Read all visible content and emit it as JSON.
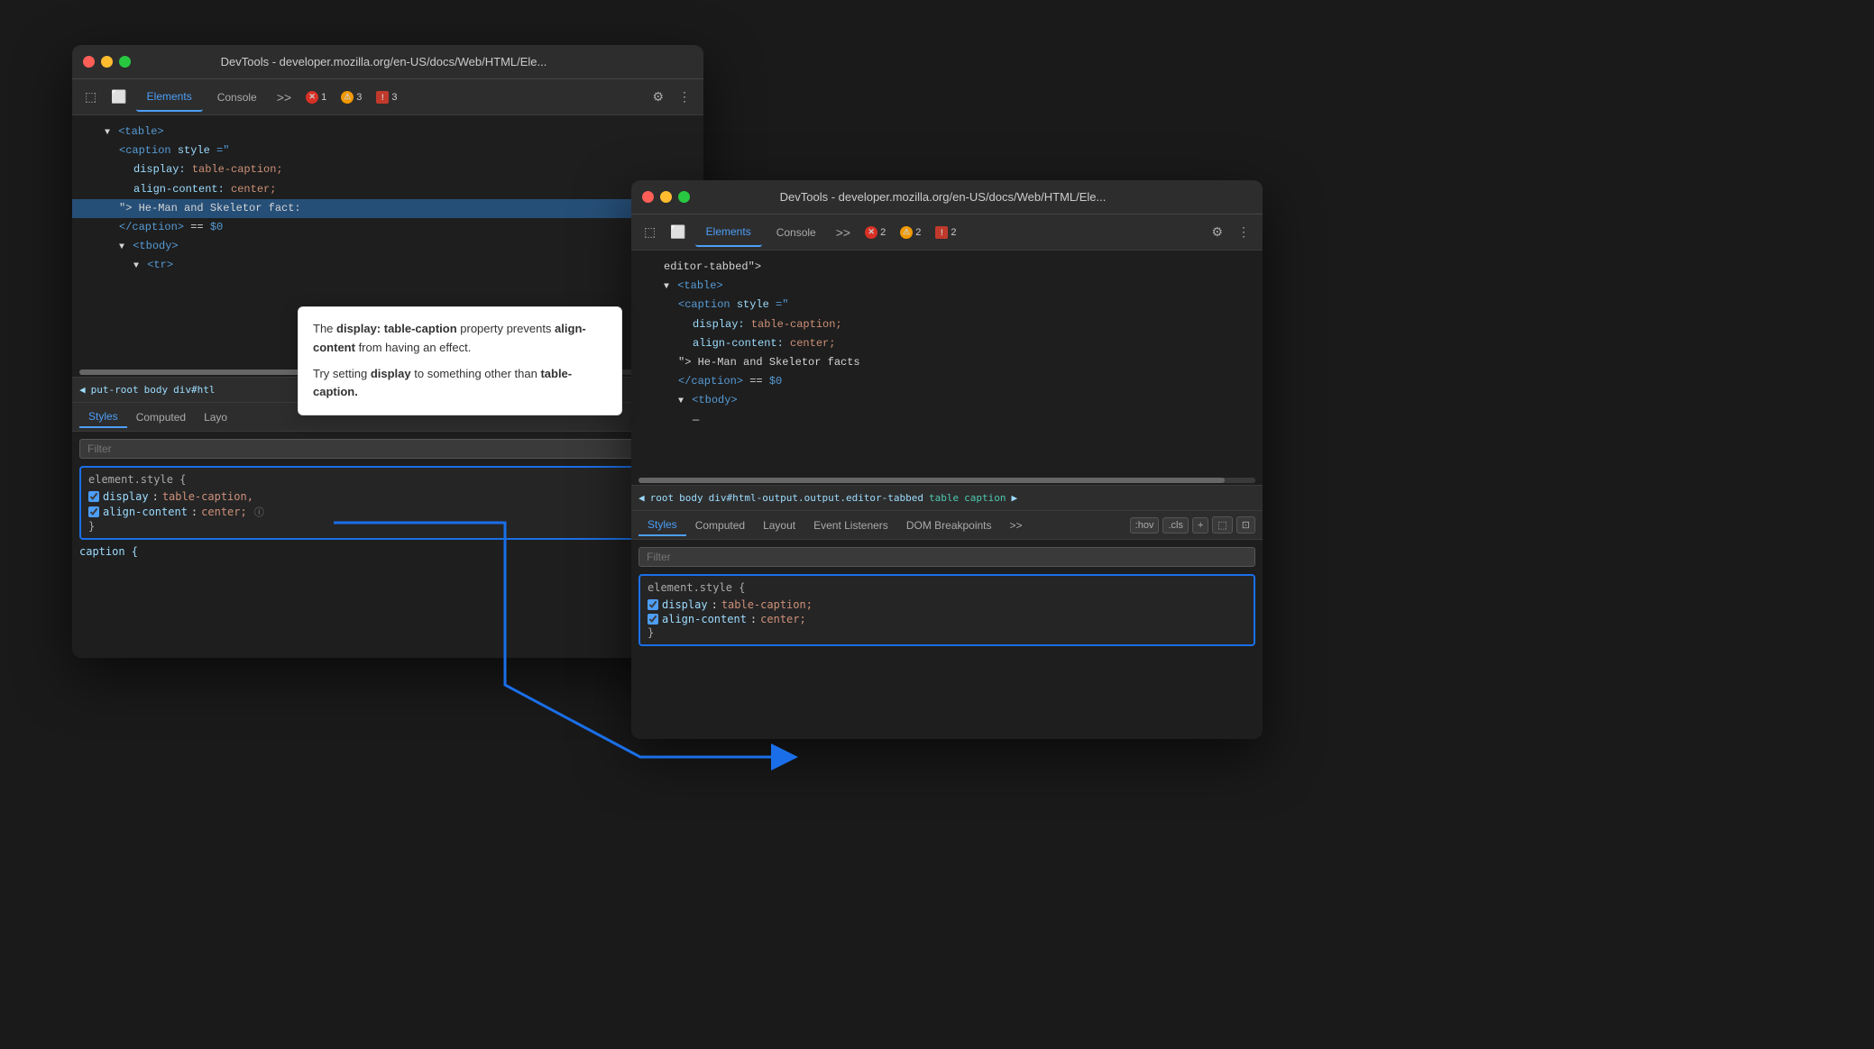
{
  "window1": {
    "title": "DevTools - developer.mozilla.org/en-US/docs/Web/HTML/Ele...",
    "tabs": [
      "Elements",
      "Console"
    ],
    "activeTab": "Elements",
    "badgeError": "1",
    "badgeWarn": "3",
    "badgeInfo": "3",
    "htmlTree": [
      {
        "indent": 0,
        "content": "▼ <table>",
        "type": "tag"
      },
      {
        "indent": 1,
        "content": "<caption style=\"",
        "type": "tag"
      },
      {
        "indent": 2,
        "content": "display: table-caption;",
        "type": "css"
      },
      {
        "indent": 2,
        "content": "align-content: center;",
        "type": "css"
      },
      {
        "indent": 1,
        "content": "\"> He-Man and Skeletor fact:",
        "type": "text",
        "selected": true
      },
      {
        "indent": 1,
        "content": "</caption> == $0",
        "type": "tag"
      },
      {
        "indent": 1,
        "content": "▼ <tbody>",
        "type": "tag"
      },
      {
        "indent": 2,
        "content": "▼ <tr>",
        "type": "tag"
      }
    ],
    "breadcrumb": [
      "◀",
      "put-root",
      "body",
      "div#htl"
    ],
    "panelTabs": [
      "Styles",
      "Computed",
      "Layo"
    ],
    "filterPlaceholder": "Filter",
    "styleRule": {
      "header": "element.style {",
      "props": [
        {
          "name": "display",
          "value": "table-caption,",
          "checked": true
        },
        {
          "name": "align-content",
          "value": "center;",
          "checked": true
        }
      ],
      "footer": "}"
    }
  },
  "window2": {
    "title": "DevTools - developer.mozilla.org/en-US/docs/Web/HTML/Ele...",
    "tabs": [
      "Elements",
      "Console"
    ],
    "activeTab": "Elements",
    "badgeError": "2",
    "badgeWarn": "2",
    "badgeInfo": "2",
    "htmlTree": [
      {
        "indent": 0,
        "content": "editor-tabbed\">",
        "type": "text"
      },
      {
        "indent": 0,
        "content": "▼ <table>",
        "type": "tag"
      },
      {
        "indent": 1,
        "content": "<caption style=\"",
        "type": "tag"
      },
      {
        "indent": 2,
        "content": "display: table-caption;",
        "type": "css"
      },
      {
        "indent": 2,
        "content": "align-content: center;",
        "type": "css"
      },
      {
        "indent": 1,
        "content": "\"> He-Man and Skeletor facts",
        "type": "text"
      },
      {
        "indent": 1,
        "content": "</caption> == $0",
        "type": "tag"
      },
      {
        "indent": 1,
        "content": "▼ <tbody>",
        "type": "tag"
      },
      {
        "indent": 2,
        "content": "—",
        "type": "text"
      }
    ],
    "breadcrumb": [
      "◀",
      "root",
      "body",
      "div#html-output.output.editor-tabbed",
      "table",
      "caption",
      "▶"
    ],
    "panelTabs": [
      "Styles",
      "Computed",
      "Layout",
      "Event Listeners",
      "DOM Breakpoints",
      ">>"
    ],
    "filterPlaceholder": "Filter",
    "hovBtn": ":hov",
    "clsBtn": ".cls",
    "styleRule": {
      "header": "element.style {",
      "props": [
        {
          "name": "display",
          "value": "table-caption;",
          "checked": true
        },
        {
          "name": "align-content",
          "value": "center;",
          "checked": true
        }
      ],
      "footer": "}"
    }
  },
  "tooltip": {
    "text1": "The",
    "bold1": "display: table-caption",
    "text2": "property prevents",
    "bold2": "align-content",
    "text3": "from having an effect.",
    "text4": "Try setting",
    "bold3": "display",
    "text5": "to something other than",
    "bold4": "table-caption.",
    "line1": "The display: table-caption property prevents align-content from having an effect.",
    "line2": "Try setting display to something other than table-caption."
  },
  "icons": {
    "inspector": "⬚",
    "device": "⬜",
    "more": ">>",
    "settings": "⚙",
    "menu": "⋮",
    "breadcrumbBack": "◀"
  }
}
